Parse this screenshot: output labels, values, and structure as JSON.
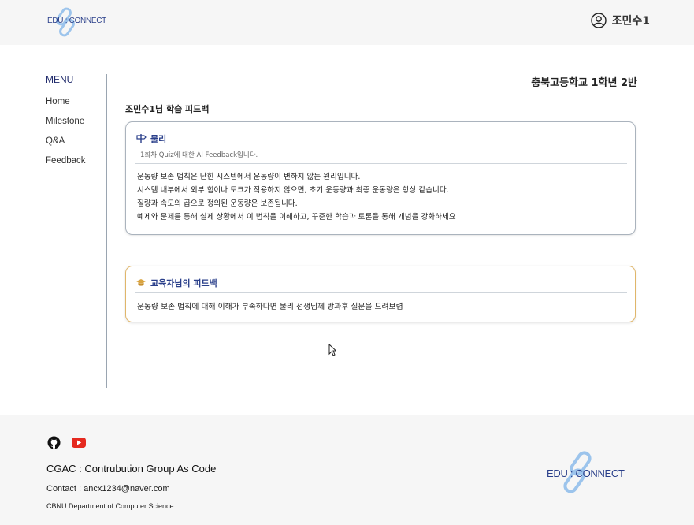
{
  "header": {
    "logo_text": "EDU : CONNECT",
    "user_name": "조민수1"
  },
  "sidebar": {
    "title": "MENU",
    "items": [
      {
        "label": "Home"
      },
      {
        "label": "Milestone"
      },
      {
        "label": "Q&A"
      },
      {
        "label": "Feedback"
      }
    ]
  },
  "main": {
    "school_class": "충북고등학교 1학년 2반",
    "page_title": "조민수1님 학습 피드백",
    "ai_feedback": {
      "subject": "물리",
      "subtitle": "1회차 Quiz에 대한 AI Feedback입니다.",
      "lines": [
        "운동량 보존 법칙은 닫힌 시스템에서 운동량이 변하지 않는 원리입니다.",
        " 시스템 내부에서 외부 힘이나 토크가 작용하지 않으면, 초기 운동량과 최종 운동량은 항상 같습니다.",
        " 질량과 속도의 곱으로 정의된 운동량은 보존됩니다.",
        "예제와 문제를 통해 실제 상황에서 이 법칙을 이해하고, 꾸준한 학습과 토론을 통해 개념을 강화하세요"
      ]
    },
    "teacher_feedback": {
      "title": "교육자님의 피드백",
      "body": "운동량 보존 법칙에 대해 이해가 부족하다면 물리 선생님께 방과후 질문을 드려보렴"
    }
  },
  "footer": {
    "org": "CGAC : Contrubution Group As Code",
    "contact": "Contact : ancx1234@naver.com",
    "dept": "CBNU Department of Computer Science",
    "logo_text": "EDU : CONNECT",
    "icons": [
      "github-icon",
      "youtube-icon"
    ]
  },
  "colors": {
    "brand": "#2a3f8a",
    "logo_link": "#9cc4ec",
    "teacher_border": "#e0b66a",
    "youtube": "#e5291f"
  }
}
